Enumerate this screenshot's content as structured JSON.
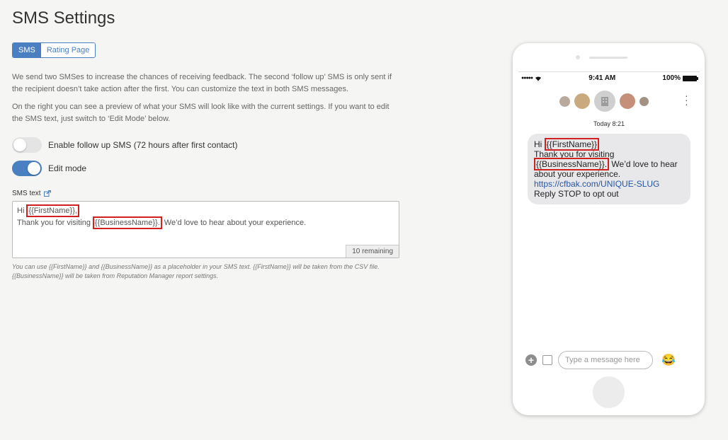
{
  "page": {
    "title": "SMS Settings"
  },
  "tabs": [
    {
      "label": "SMS",
      "active": true
    },
    {
      "label": "Rating Page",
      "active": false
    }
  ],
  "intro": {
    "p1": "We send two SMSes to increase the chances of receiving feedback. The second ‘follow up’ SMS is only sent if the recipient doesn’t take action after the first. You can customize the text in both SMS messages.",
    "p2": "On the right you can see a preview of what your SMS will look like with the current settings. If you want to edit the SMS text, just switch to ‘Edit Mode’ below."
  },
  "toggles": {
    "follow_up": {
      "label": "Enable follow up SMS (72 hours after first contact)",
      "on": false
    },
    "edit_mode": {
      "label": "Edit mode",
      "on": true
    }
  },
  "sms_text": {
    "label": "SMS text",
    "line1_prefix": "Hi ",
    "first_name": "{{FirstName}},",
    "line2_prefix": "Thank you for visiting ",
    "business_name": "{{BusinessName}}.",
    "line2_suffix": " We’d love to hear about your experience.",
    "remaining": "10 remaining"
  },
  "help_text": "You can use {{FirstName}} and {{BusinessName}} as a placeholder in your SMS text. {{FirstName}} will be taken from the CSV file. {{BusinessName}} will be taken from Reputation Manager report settings.",
  "phone": {
    "status": {
      "time": "9:41 AM",
      "battery": "100%"
    },
    "thread_time": "Today 8:21",
    "message": {
      "prefix": "Hi ",
      "first_name": "{{FirstName}}",
      "line2": "Thank you for visiting",
      "business_name": "{{BusinessName}}.",
      "after_business": " We’d love to hear about your experience.",
      "link": "https://cfbak.com/UNIQUE-SLUG",
      "opt_out": "Reply STOP to opt out"
    },
    "composer_placeholder": "Type a message here"
  },
  "colors": {
    "accent": "#4a7fc1",
    "highlight": "#d12020"
  }
}
